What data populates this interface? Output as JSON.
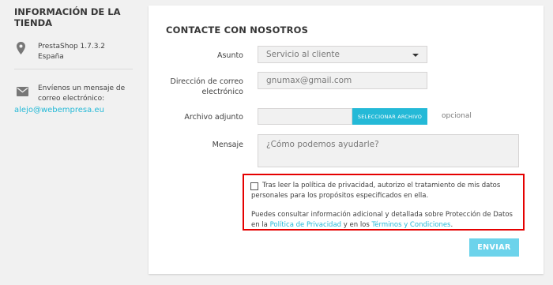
{
  "store": {
    "title": "Información de la tienda",
    "address_line1": "PrestaShop 1.7.3.2",
    "address_line2": "España",
    "email_prompt_line1": "Envíenos un mensaje de",
    "email_prompt_line2": "correo electrónico:",
    "email": "alejo@webempresa.eu"
  },
  "form": {
    "title": "CONTACTE CON NOSOTROS",
    "subject_label": "Asunto",
    "subject_value": "Servicio al cliente",
    "email_label_line1": "Dirección de correo",
    "email_label_line2": "electrónico",
    "email_value": "gnumax@gmail.com",
    "attachment_label": "Archivo adjunto",
    "file_button": "SELECCIONAR ARCHIVO",
    "optional": "opcional",
    "message_label": "Mensaje",
    "message_placeholder": "¿Cómo podemos ayudarle?",
    "consent_text": "Tras leer la política de privacidad, autorizo el tratamiento de mis datos personales para los propósitos especificados en ella.",
    "more_info_text": "Puedes consultar información adicional y detallada sobre Protección de Datos en la",
    "privacy_link": "Política de Privacidad",
    "and_text": "y en los",
    "terms_link": "Términos y Condiciones",
    "period": ".",
    "send_button": "ENVIAR"
  },
  "colors": {
    "accent": "#24b9d7",
    "highlight_border": "#e50000",
    "send_button": "#6cd3eb"
  }
}
